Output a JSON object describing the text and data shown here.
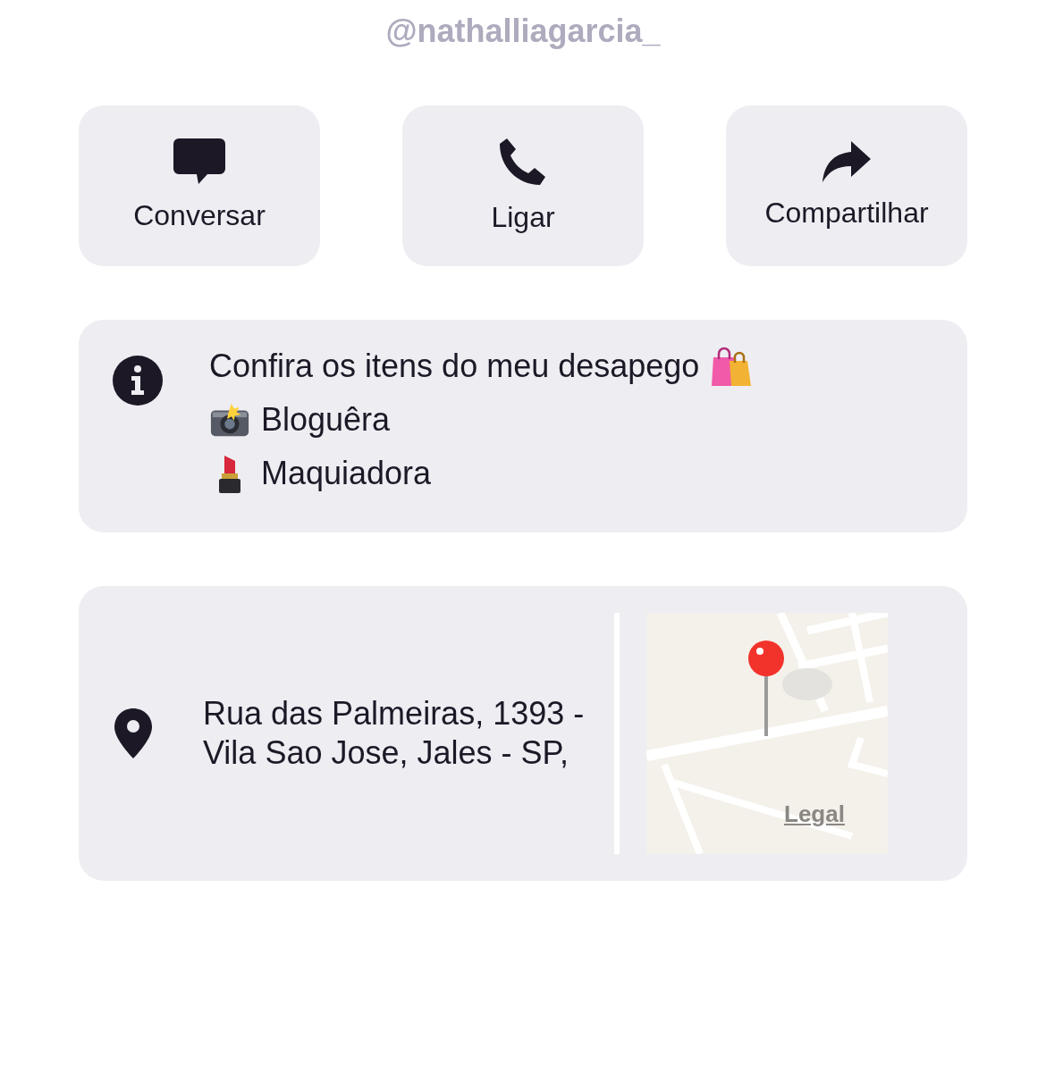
{
  "username": "@nathalliagarcia_",
  "actions": [
    {
      "label": "Conversar",
      "kind": "chat"
    },
    {
      "label": "Ligar",
      "kind": "phone"
    },
    {
      "label": "Compartilhar",
      "kind": "share"
    }
  ],
  "bio": {
    "lines": [
      {
        "text": "Confira os itens do meu desapego",
        "kind": "bags"
      },
      {
        "text": "Bloguêra",
        "kind": "camera"
      },
      {
        "text": "Maquiadora",
        "kind": "lipstick"
      }
    ]
  },
  "address": {
    "lines": [
      "Rua das Palmeiras, 1393 -",
      "Vila Sao Jose, Jales - SP,"
    ],
    "map": {
      "kind": "picture",
      "legal_link": "Legal"
    }
  }
}
